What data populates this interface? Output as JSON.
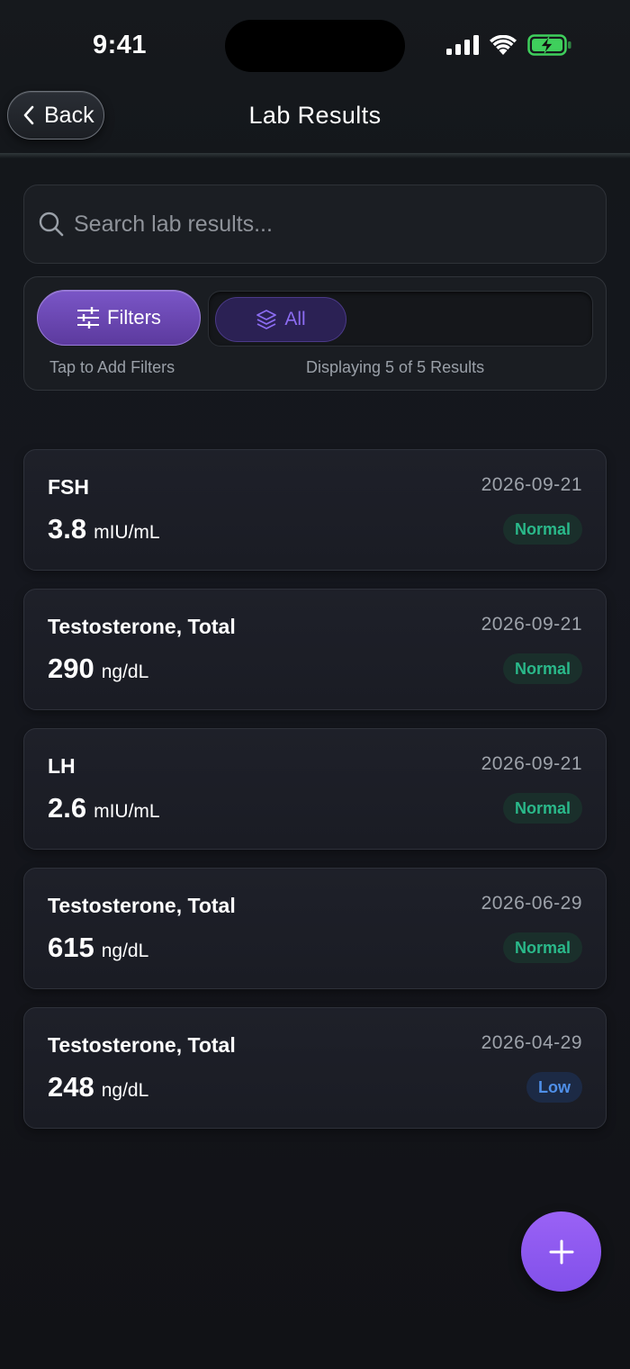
{
  "status_bar": {
    "time": "9:41",
    "icons": [
      "cellular-signal-icon",
      "wifi-icon",
      "battery-charging-icon"
    ]
  },
  "nav": {
    "back_label": "Back",
    "title": "Lab Results"
  },
  "search": {
    "placeholder": "Search lab results...",
    "value": ""
  },
  "filters": {
    "button_label": "Filters",
    "chip_label": "All",
    "hint": "Tap to Add Filters",
    "result_count": "Displaying 5 of 5 Results"
  },
  "results": [
    {
      "name": "FSH",
      "value": "3.8",
      "unit": "mIU/mL",
      "date": "2026-09-21",
      "status": "Normal"
    },
    {
      "name": "Testosterone, Total",
      "value": "290",
      "unit": "ng/dL",
      "date": "2026-09-21",
      "status": "Normal"
    },
    {
      "name": "LH",
      "value": "2.6",
      "unit": "mIU/mL",
      "date": "2026-09-21",
      "status": "Normal"
    },
    {
      "name": "Testosterone, Total",
      "value": "615",
      "unit": "ng/dL",
      "date": "2026-06-29",
      "status": "Normal"
    },
    {
      "name": "Testosterone, Total",
      "value": "248",
      "unit": "ng/dL",
      "date": "2026-04-29",
      "status": "Low"
    }
  ],
  "colors": {
    "accent": "#8a5cf0",
    "normal": "#2ab98a",
    "low": "#4f8fe8"
  }
}
